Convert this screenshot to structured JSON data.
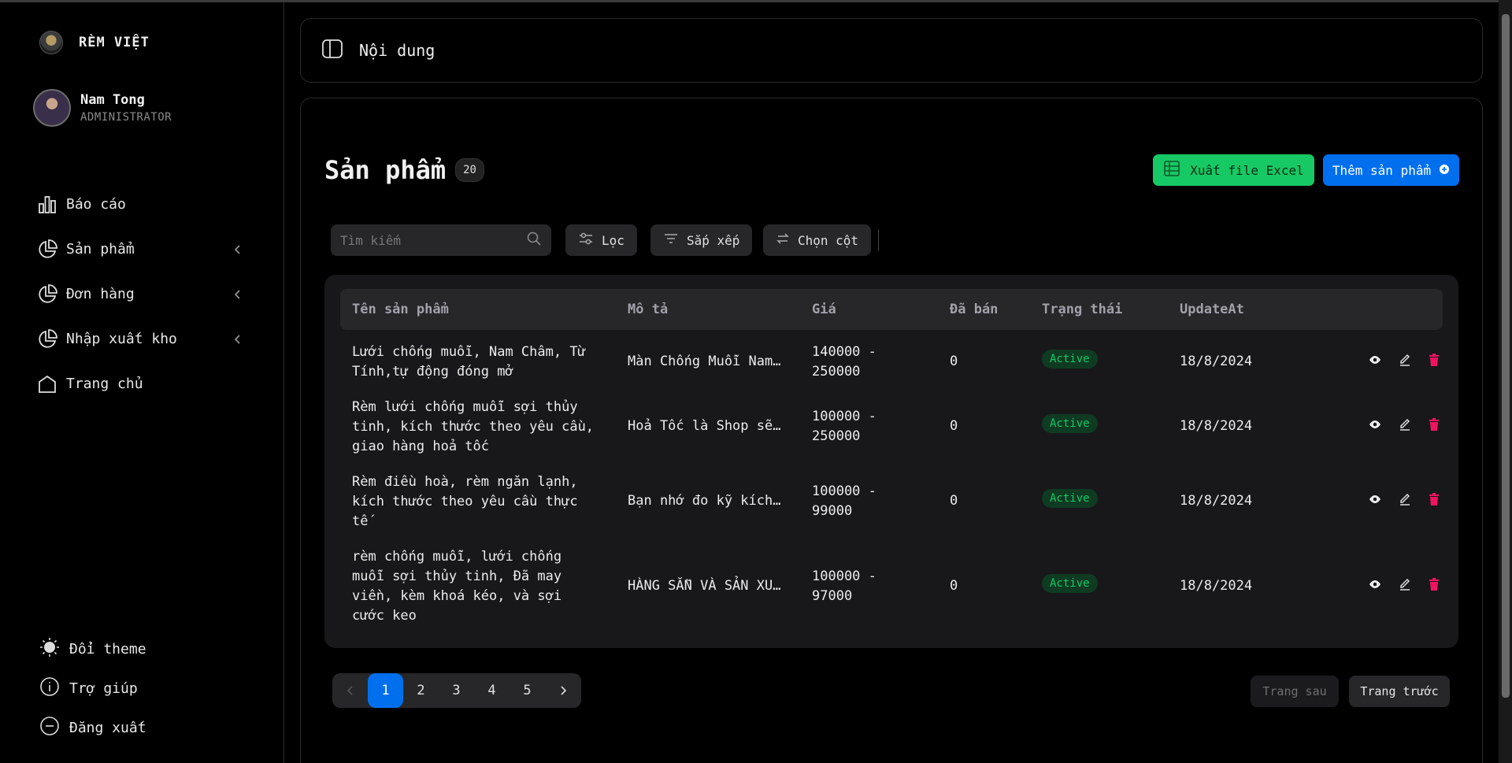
{
  "brand": {
    "name": "RÈM VIỆT"
  },
  "user": {
    "name": "Nam Tong",
    "role": "ADMINISTRATOR"
  },
  "sidebar": {
    "items": [
      {
        "label": "Báo cáo",
        "icon": "bar-chart-icon"
      },
      {
        "label": "Sản phẩm",
        "icon": "pie-chart-icon"
      },
      {
        "label": "Đơn hàng",
        "icon": "pie-chart-icon"
      },
      {
        "label": "Nhập xuất kho",
        "icon": "pie-chart-icon"
      },
      {
        "label": "Trang chủ",
        "icon": "home-icon"
      }
    ],
    "bottom": [
      {
        "label": "Đổi theme",
        "icon": "sun-icon"
      },
      {
        "label": "Trợ giúp",
        "icon": "info-icon"
      },
      {
        "label": "Đăng xuất",
        "icon": "logout-icon"
      }
    ]
  },
  "topbar": {
    "title": "Nội dung"
  },
  "page": {
    "title": "Sản phẩm",
    "count": "20",
    "export_label": "Xuất file Excel",
    "add_label": "Thêm sản phẩm"
  },
  "toolbar": {
    "search_placeholder": "Tìm kiếm",
    "filter_label": "Lọc",
    "sort_label": "Sắp xếp",
    "columns_label": "Chọn cột"
  },
  "table": {
    "headers": [
      "Tên sản phẩm",
      "Mô tả",
      "Giá",
      "Đã bán",
      "Trạng thái",
      "UpdateAt"
    ],
    "rows": [
      {
        "name": [
          "Lưới chống muỗi, Nam Châm, Từ",
          "Tính,tự động đóng mở"
        ],
        "desc": "Màn Chống Muỗi Nam…",
        "price": [
          "140000 -",
          "250000"
        ],
        "sold": "0",
        "status": "Active",
        "updated": "18/8/2024"
      },
      {
        "name": [
          "Rèm lưới chống muỗi sợi thủy",
          "tinh, kích thước theo yêu cầu,",
          "giao hàng hoả tốc"
        ],
        "desc": "Hoả Tốc là Shop sẽ…",
        "price": [
          "100000 -",
          "250000"
        ],
        "sold": "0",
        "status": "Active",
        "updated": "18/8/2024"
      },
      {
        "name": [
          "Rèm điều hoà, rèm ngăn lạnh,",
          "kích thước theo yêu cầu thực",
          "tế"
        ],
        "desc": "Bạn nhớ đo kỹ kích…",
        "price": [
          "100000 -",
          "99000"
        ],
        "sold": "0",
        "status": "Active",
        "updated": "18/8/2024"
      },
      {
        "name": [
          "rèm chống muỗi, lưới chống",
          "muỗi sợi thủy tinh, Đã may",
          "viền, kèm khoá kéo, và sợi",
          "cước keo"
        ],
        "desc": "HÀNG SẴN VÀ SẢN XU…",
        "price": [
          "100000 -",
          "97000"
        ],
        "sold": "0",
        "status": "Active",
        "updated": "18/8/2024"
      }
    ]
  },
  "pagination": {
    "pages": [
      "1",
      "2",
      "3",
      "4",
      "5"
    ],
    "current": "1",
    "next_label": "Trang sau",
    "prev_label": "Trang trước"
  },
  "colors": {
    "accent": "#006fee",
    "success": "#17c964",
    "danger": "#f31260"
  }
}
